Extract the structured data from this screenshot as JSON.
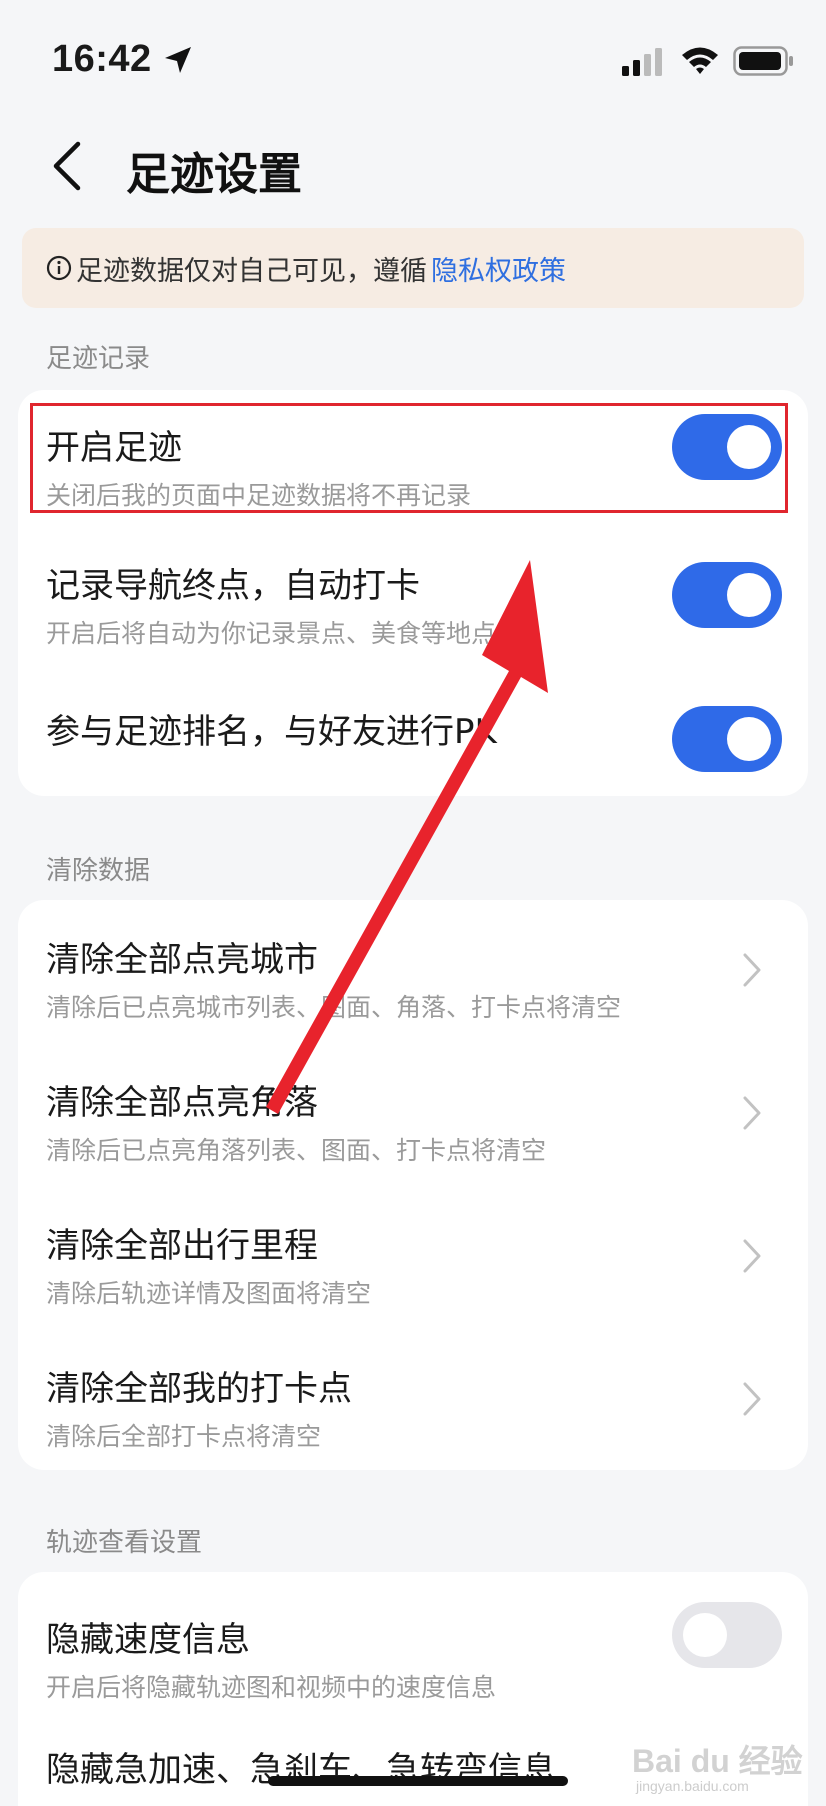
{
  "status_bar": {
    "time": "16:42"
  },
  "nav": {
    "title": "足迹设置"
  },
  "notice": {
    "text": "足迹数据仅对自己可见，遵循",
    "link": "隐私权政策"
  },
  "sections": {
    "record": {
      "header": "足迹记录",
      "items": [
        {
          "title": "开启足迹",
          "subtitle": "关闭后我的页面中足迹数据将不再记录",
          "enabled": true
        },
        {
          "title": "记录导航终点，自动打卡",
          "subtitle": "开启后将自动为你记录景点、美食等地点",
          "enabled": true
        },
        {
          "title": "参与足迹排名，与好友进行PK",
          "enabled": true
        }
      ]
    },
    "clear": {
      "header": "清除数据",
      "items": [
        {
          "title": "清除全部点亮城市",
          "subtitle": "清除后已点亮城市列表、图面、角落、打卡点将清空"
        },
        {
          "title": "清除全部点亮角落",
          "subtitle": "清除后已点亮角落列表、图面、打卡点将清空"
        },
        {
          "title": "清除全部出行里程",
          "subtitle": "清除后轨迹详情及图面将清空"
        },
        {
          "title": "清除全部我的打卡点",
          "subtitle": "清除后全部打卡点将清空"
        }
      ]
    },
    "track": {
      "header": "轨迹查看设置",
      "items": [
        {
          "title": "隐藏速度信息",
          "subtitle": "开启后将隐藏轨迹图和视频中的速度信息",
          "enabled": false
        },
        {
          "title": "隐藏急加速、急刹车、急转弯信息"
        }
      ]
    }
  },
  "watermark": {
    "text": "Bai du 经验",
    "sub": "jingyan.baidu.com"
  }
}
